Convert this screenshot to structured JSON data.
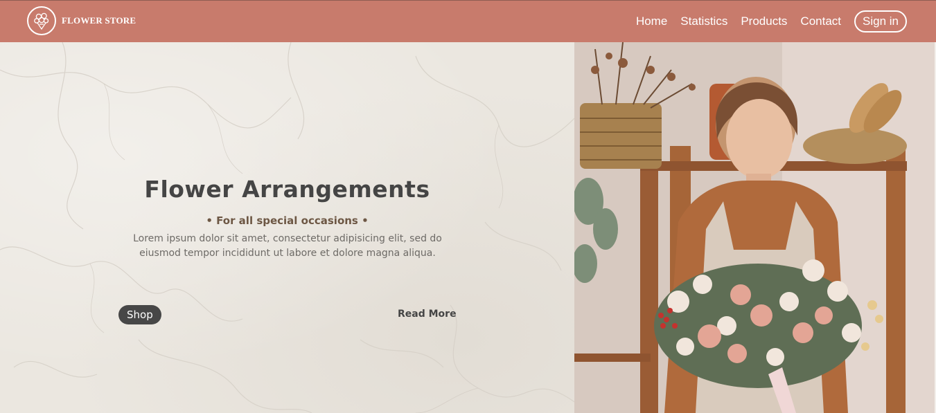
{
  "header": {
    "brand": "FLOWER STORE",
    "logo_icon": "bouquet-logo-icon",
    "nav": [
      "Home",
      "Statistics",
      "Products",
      "Contact"
    ],
    "signin_label": "Sign in"
  },
  "hero": {
    "title": "Flower Arrangements",
    "subtitle": "• For all special occasions •",
    "body": "Lorem ipsum dolor sit amet, consectetur adipisicing elit, sed do eiusmod tempor incididunt ut labore et dolore magna aliqua.",
    "shop_label": "Shop",
    "read_more_label": "Read More",
    "photo": "florist-with-bouquet-photo"
  },
  "colors": {
    "nav_bg": "#c87b6c",
    "hero_bg": "#ebe7e0",
    "title": "#454545",
    "subtitle": "#6d5744",
    "button_bg": "#474747"
  }
}
